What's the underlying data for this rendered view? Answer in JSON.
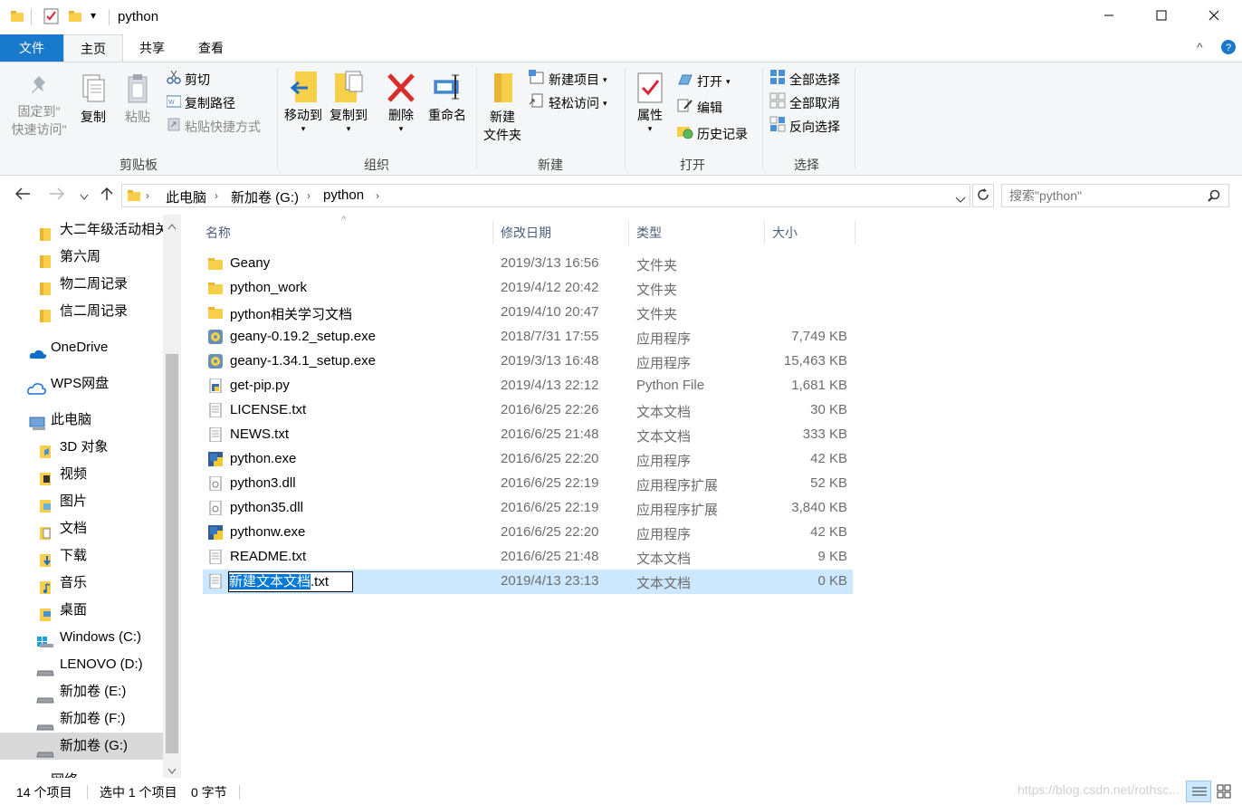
{
  "window": {
    "title": "python",
    "minimize_icon": "minimize-icon",
    "maximize_icon": "maximize-icon",
    "close_icon": "close-icon",
    "quick_access_dropdown": "▾"
  },
  "tabs": [
    {
      "label": "文件"
    },
    {
      "label": "主页"
    },
    {
      "label": "共享"
    },
    {
      "label": "查看"
    }
  ],
  "ribbon": {
    "clipboard": {
      "label": "剪贴板",
      "pin_line1": "固定到\"",
      "pin_line2": "快速访问\"",
      "copy": "复制",
      "paste": "粘贴",
      "cut": "剪切",
      "copy_path": "复制路径",
      "paste_shortcut": "粘贴快捷方式"
    },
    "organize": {
      "label": "组织",
      "move_to": "移动到",
      "copy_to": "复制到",
      "delete": "删除",
      "rename": "重命名"
    },
    "new": {
      "label": "新建",
      "new_folder_line1": "新建",
      "new_folder_line2": "文件夹",
      "new_item": "新建项目",
      "easy_access": "轻松访问"
    },
    "open": {
      "label": "打开",
      "properties": "属性",
      "open": "打开",
      "edit": "编辑",
      "history": "历史记录"
    },
    "select": {
      "label": "选择",
      "select_all": "全部选择",
      "select_none": "全部取消",
      "invert": "反向选择"
    }
  },
  "address": {
    "crumbs": [
      "此电脑",
      "新加卷 (G:)",
      "python"
    ],
    "search_placeholder": "搜索\"python\""
  },
  "nav": [
    {
      "label": "大二年级活动相关",
      "icon": "folder-icon"
    },
    {
      "label": "第六周",
      "icon": "folder-icon"
    },
    {
      "label": "物二周记录",
      "icon": "folder-icon"
    },
    {
      "label": "信二周记录",
      "icon": "folder-icon"
    },
    {
      "label": "OneDrive",
      "icon": "onedrive-icon"
    },
    {
      "label": "WPS网盘",
      "icon": "cloud-icon"
    },
    {
      "label": "此电脑",
      "icon": "computer-icon"
    },
    {
      "label": "3D 对象",
      "icon": "3d-objects-icon"
    },
    {
      "label": "视频",
      "icon": "videos-icon"
    },
    {
      "label": "图片",
      "icon": "pictures-icon"
    },
    {
      "label": "文档",
      "icon": "documents-icon"
    },
    {
      "label": "下载",
      "icon": "downloads-icon"
    },
    {
      "label": "音乐",
      "icon": "music-icon"
    },
    {
      "label": "桌面",
      "icon": "desktop-icon"
    },
    {
      "label": "Windows (C:)",
      "icon": "drive-icon"
    },
    {
      "label": "LENOVO (D:)",
      "icon": "drive-icon"
    },
    {
      "label": "新加卷 (E:)",
      "icon": "drive-icon"
    },
    {
      "label": "新加卷 (F:)",
      "icon": "drive-icon"
    },
    {
      "label": "新加卷 (G:)",
      "icon": "drive-icon"
    },
    {
      "label": "网络",
      "icon": "network-icon"
    }
  ],
  "columns": {
    "name": "名称",
    "date": "修改日期",
    "type": "类型",
    "size": "大小"
  },
  "files": [
    {
      "name": "Geany",
      "date": "2019/3/13 16:56",
      "type": "文件夹",
      "size": "",
      "icon": "folder"
    },
    {
      "name": "python_work",
      "date": "2019/4/12 20:42",
      "type": "文件夹",
      "size": "",
      "icon": "folder"
    },
    {
      "name": "python相关学习文档",
      "date": "2019/4/10 20:47",
      "type": "文件夹",
      "size": "",
      "icon": "folder"
    },
    {
      "name": "geany-0.19.2_setup.exe",
      "date": "2018/7/31 17:55",
      "type": "应用程序",
      "size": "7,749 KB",
      "icon": "setup"
    },
    {
      "name": "geany-1.34.1_setup.exe",
      "date": "2019/3/13 16:48",
      "type": "应用程序",
      "size": "15,463 KB",
      "icon": "setup"
    },
    {
      "name": "get-pip.py",
      "date": "2019/4/13 22:12",
      "type": "Python File",
      "size": "1,681 KB",
      "icon": "py"
    },
    {
      "name": "LICENSE.txt",
      "date": "2016/6/25 22:26",
      "type": "文本文档",
      "size": "30 KB",
      "icon": "doc"
    },
    {
      "name": "NEWS.txt",
      "date": "2016/6/25 21:48",
      "type": "文本文档",
      "size": "333 KB",
      "icon": "doc"
    },
    {
      "name": "python.exe",
      "date": "2016/6/25 22:20",
      "type": "应用程序",
      "size": "42 KB",
      "icon": "pyexe"
    },
    {
      "name": "python3.dll",
      "date": "2016/6/25 22:19",
      "type": "应用程序扩展",
      "size": "52 KB",
      "icon": "dll"
    },
    {
      "name": "python35.dll",
      "date": "2016/6/25 22:19",
      "type": "应用程序扩展",
      "size": "3,840 KB",
      "icon": "dll"
    },
    {
      "name": "pythonw.exe",
      "date": "2016/6/25 22:20",
      "type": "应用程序",
      "size": "42 KB",
      "icon": "pyexe"
    },
    {
      "name": "README.txt",
      "date": "2016/6/25 21:48",
      "type": "文本文档",
      "size": "9 KB",
      "icon": "doc"
    }
  ],
  "renaming": {
    "name_selected": "新建文本文档",
    "name_ext": ".txt",
    "date": "2019/4/13 23:13",
    "type": "文本文档",
    "size": "0 KB"
  },
  "status": {
    "count": "14 个项目",
    "selection": "选中 1 个项目",
    "size": "0 字节"
  },
  "watermark": "https://blog.csdn.net/rothsc..."
}
